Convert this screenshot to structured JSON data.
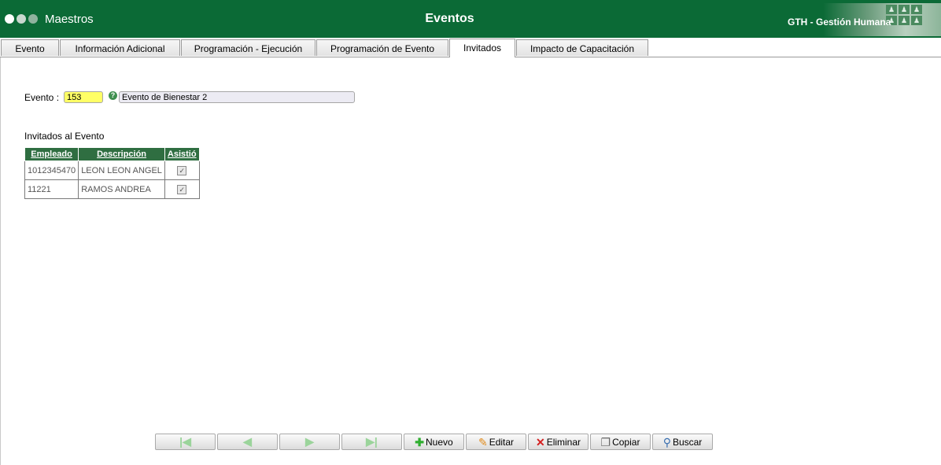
{
  "header": {
    "section": "Maestros",
    "title": "Eventos",
    "app_name": "GTH - Gestión Humana"
  },
  "tabs": [
    {
      "label": "Evento",
      "active": false
    },
    {
      "label": "Información Adicional",
      "active": false
    },
    {
      "label": "Programación - Ejecución",
      "active": false
    },
    {
      "label": "Programación de Evento",
      "active": false
    },
    {
      "label": "Invitados",
      "active": true
    },
    {
      "label": "Impacto de Capacitación",
      "active": false
    }
  ],
  "form": {
    "evento_label": "Evento :",
    "evento_code": "153",
    "evento_description": "Evento de Bienestar 2",
    "help_icon": "?"
  },
  "guests": {
    "title": "Invitados al Evento",
    "columns": [
      "Empleado",
      "Descripción",
      "Asistió"
    ],
    "rows": [
      {
        "empleado": "1012345470",
        "descripcion": "LEON LEON ANGEL",
        "asistio": true
      },
      {
        "empleado": "11221",
        "descripcion": "RAMOS ANDREA",
        "asistio": true
      }
    ]
  },
  "toolbar": {
    "nuevo": "Nuevo",
    "editar": "Editar",
    "eliminar": "Eliminar",
    "copiar": "Copiar",
    "buscar": "Buscar",
    "icons": [
      "first-icon",
      "prev-icon",
      "next-icon",
      "last-icon",
      "plus-icon",
      "pencil-icon",
      "x-icon",
      "copy-icon",
      "search-icon"
    ]
  },
  "colors": {
    "header_bg": "#0b6a36",
    "grid_header_bg": "#2f6e41",
    "code_input_bg": "#ffff66"
  }
}
